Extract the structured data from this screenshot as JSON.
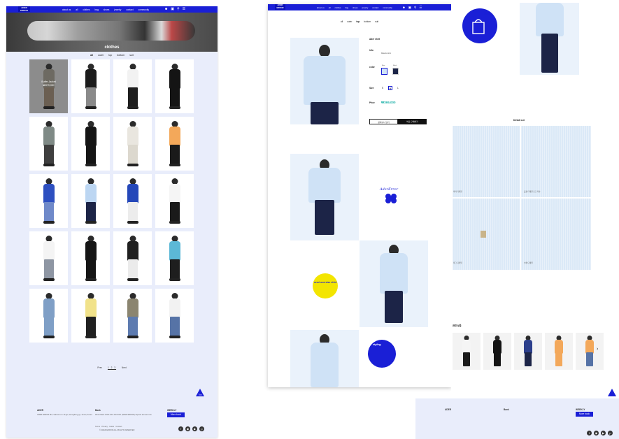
{
  "left_page": {
    "logo": "ADER ERROR",
    "nav": [
      "about us",
      "all",
      "clothes",
      "bag",
      "shoes",
      "jewelry",
      "contact",
      "community"
    ],
    "hero_title": "clothes",
    "categories": [
      "all",
      "outer",
      "top",
      "bottom",
      "suit"
    ],
    "active_category": "all",
    "products": [
      {
        "top": "#6d6a62",
        "bottom": "#6b5f52",
        "overlay": [
          "Buffer Jacket",
          "₩379,000"
        ]
      },
      {
        "top": "#1b1b1b",
        "bottom": "#8a8a8a"
      },
      {
        "top": "#f2f2f2",
        "bottom": "#1e1e1e"
      },
      {
        "top": "#141414",
        "bottom": "#141414"
      },
      {
        "top": "#7f8a86",
        "bottom": "#3f3f3f"
      },
      {
        "top": "#151515",
        "bottom": "#151515"
      },
      {
        "top": "#e9e6df",
        "bottom": "#dcd8ce"
      },
      {
        "top": "#f3a85a",
        "bottom": "#1a1a1a"
      },
      {
        "top": "#2d4fc0",
        "bottom": "#6f89c9"
      },
      {
        "top": "#bcd6f2",
        "bottom": "#1c2447"
      },
      {
        "top": "#2447b9",
        "bottom": "#ececec"
      },
      {
        "top": "#f5f5f5",
        "bottom": "#1a1a1a"
      },
      {
        "top": "#f4f4f4",
        "bottom": "#8e96a3"
      },
      {
        "top": "#151515",
        "bottom": "#151515"
      },
      {
        "top": "#1f1f1f",
        "bottom": "#ebebeb"
      },
      {
        "top": "#5cb8d6",
        "bottom": "#1e1e1e"
      },
      {
        "top": "#7f9fc6",
        "bottom": "#7f9fc6"
      },
      {
        "top": "#f1e28a",
        "bottom": "#202020"
      },
      {
        "top": "#8b8570",
        "bottom": "#5d7bb0"
      },
      {
        "top": "#f2f2f2",
        "bottom": "#5673a6"
      }
    ],
    "pagination": {
      "prev": "Prev",
      "pages": "1 2 3",
      "next": "Next"
    },
    "top_button": "Top",
    "footer": {
      "col1_title": "ADER",
      "col1_text": "ADER ERROR 8F, Ttukseom-ro 13-gil, Seongdong-gu, Seoul, Korea",
      "col2_title": "Bank",
      "col2_text": "Woori Bank 1005-XXX-XXXXXX (ADER ERROR) deposit account info",
      "col3_title": "WEEKLY",
      "more_button": "More book",
      "links": "Terms · Privacy · Guide · Contact",
      "copyright": "© ADER ERROR ALL RIGHTS RESERVED",
      "social_icons": [
        "facebook-icon",
        "instagram-icon",
        "youtube-icon",
        "pinterest-icon"
      ]
    }
  },
  "mid_page": {
    "logo": "ADER ERROR",
    "nav": [
      "about us",
      "all",
      "clothes",
      "bag",
      "shoes",
      "jewelry",
      "contact",
      "community"
    ],
    "categories": [
      "all",
      "outer",
      "top",
      "bottom",
      "suit"
    ],
    "active_category": "top",
    "product": {
      "name": "Ader shirt",
      "info_label": "Info",
      "info_text": "Material info",
      "color_label": "color",
      "colors": [
        "Blue",
        "Black"
      ],
      "size_label": "Size",
      "sizes": [
        "S",
        "M",
        "L"
      ],
      "selected_size": "M",
      "price_label": "Price",
      "price": "₩369,000",
      "cart_button": "장바구니 담기",
      "buy_button": "바로 구매하기"
    },
    "badge_text": "semi oversize shirt",
    "script_logo": "AderError",
    "styling_label": "styling"
  },
  "right_page": {
    "styling_label": "styling",
    "styling_sub": "look & curating",
    "detail_title": "Detail cut",
    "captions": [
      "카라 디테일",
      "포켓 디테일 로고 자수",
      "태그 디테일",
      "소매 디테일"
    ],
    "related_title": "관련 상품",
    "related_items": [
      {
        "top": "#f5f5f5",
        "bottom": "#1b1b1b"
      },
      {
        "top": "#141414",
        "bottom": "#141414"
      },
      {
        "top": "#2c3f8c",
        "bottom": "#1c2447"
      },
      {
        "top": "#f3a85a",
        "bottom": "#f3a85a"
      },
      {
        "top": "#f3a85a",
        "bottom": "#5673a6"
      }
    ],
    "footer": {
      "col1_title": "ADER",
      "col2_title": "Bank",
      "col3_title": "WEEKLY",
      "more_button": "More book"
    }
  }
}
